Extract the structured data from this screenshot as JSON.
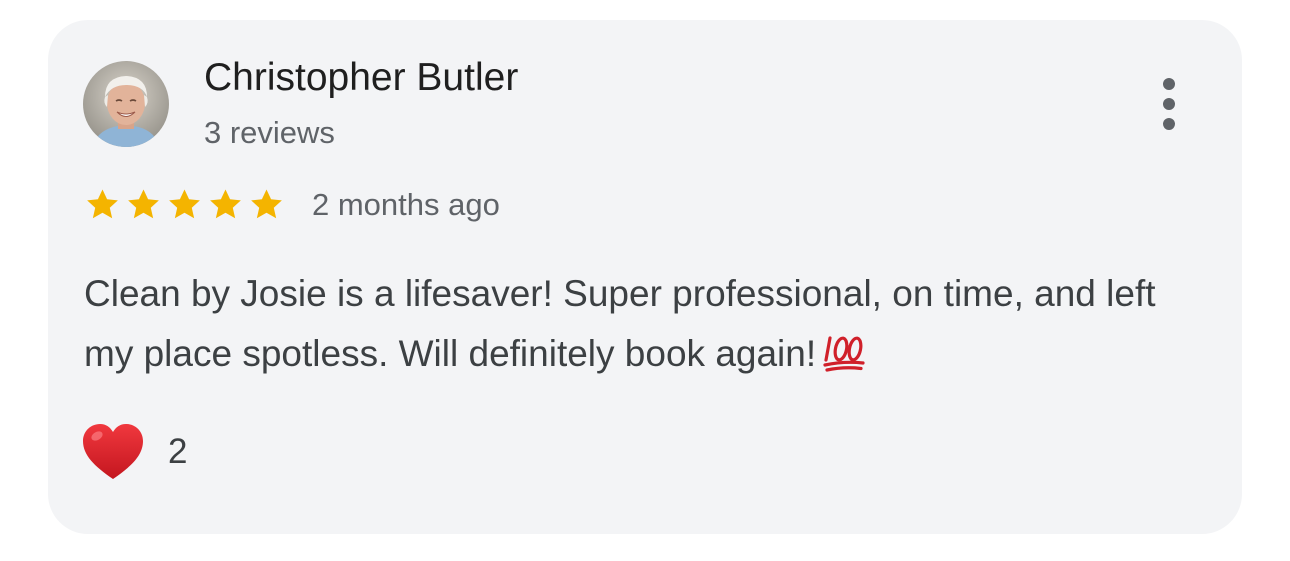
{
  "review": {
    "reviewer_name": "Christopher Butler",
    "reviewer_meta": "3 reviews",
    "rating": 5,
    "rating_max": 5,
    "date": "2 months ago",
    "text": "Clean by Josie is a lifesaver! Super professional, on time, and left my place spotless. Will definitely book again!",
    "text_emoji": "💯",
    "reaction_icon": "heart-icon",
    "reaction_count": "2"
  },
  "icons": {
    "menu": "more-vert-icon",
    "star": "star-icon"
  },
  "colors": {
    "card_background": "#f3f4f6",
    "star": "#f4b400",
    "heart": "#e0242e",
    "hundred": "#d0202a",
    "name_text": "#1f1f1f",
    "secondary_text": "#5f6368"
  }
}
